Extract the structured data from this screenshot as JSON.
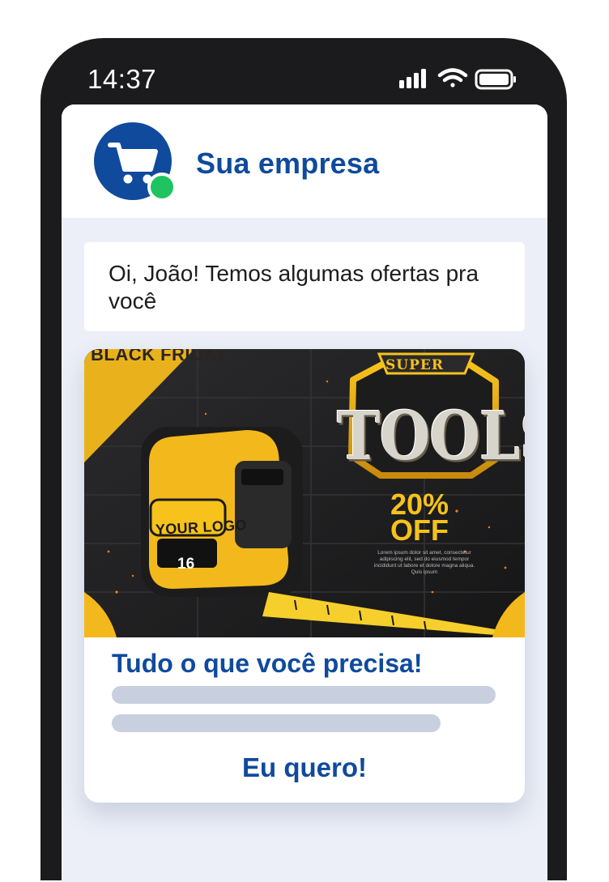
{
  "status_bar": {
    "time": "14:37",
    "icons": [
      "signal-icon",
      "wifi-icon",
      "battery-icon"
    ]
  },
  "chat_header": {
    "company_name": "Sua empresa",
    "avatar_icon": "shopping-cart-icon",
    "status": "online"
  },
  "message": {
    "text": "Oi, João! Temos algumas ofertas pra você"
  },
  "offer_card": {
    "image": {
      "corner_label": "BLACK FRIDAY",
      "super_label": "SUPER",
      "headline": "TOOLS",
      "discount": "20% OFF",
      "small_text": "Lorem ipsum dolor sit amet, consectetur adipiscing elit, sed do eiusmod tempor incididunt ut labore et dolore magna aliqua. Quis ipsum",
      "product_logo": "YOUR LOGO",
      "product_number": "16"
    },
    "title": "Tudo o que você precisa!",
    "cta_label": "Eu quero!"
  },
  "colors": {
    "brand_blue": "#0f4a9d",
    "online_green": "#1fc460",
    "accent_yellow": "#f6c21b",
    "phone_frame": "#1b1b1d",
    "screen_bg": "#eceff7"
  }
}
